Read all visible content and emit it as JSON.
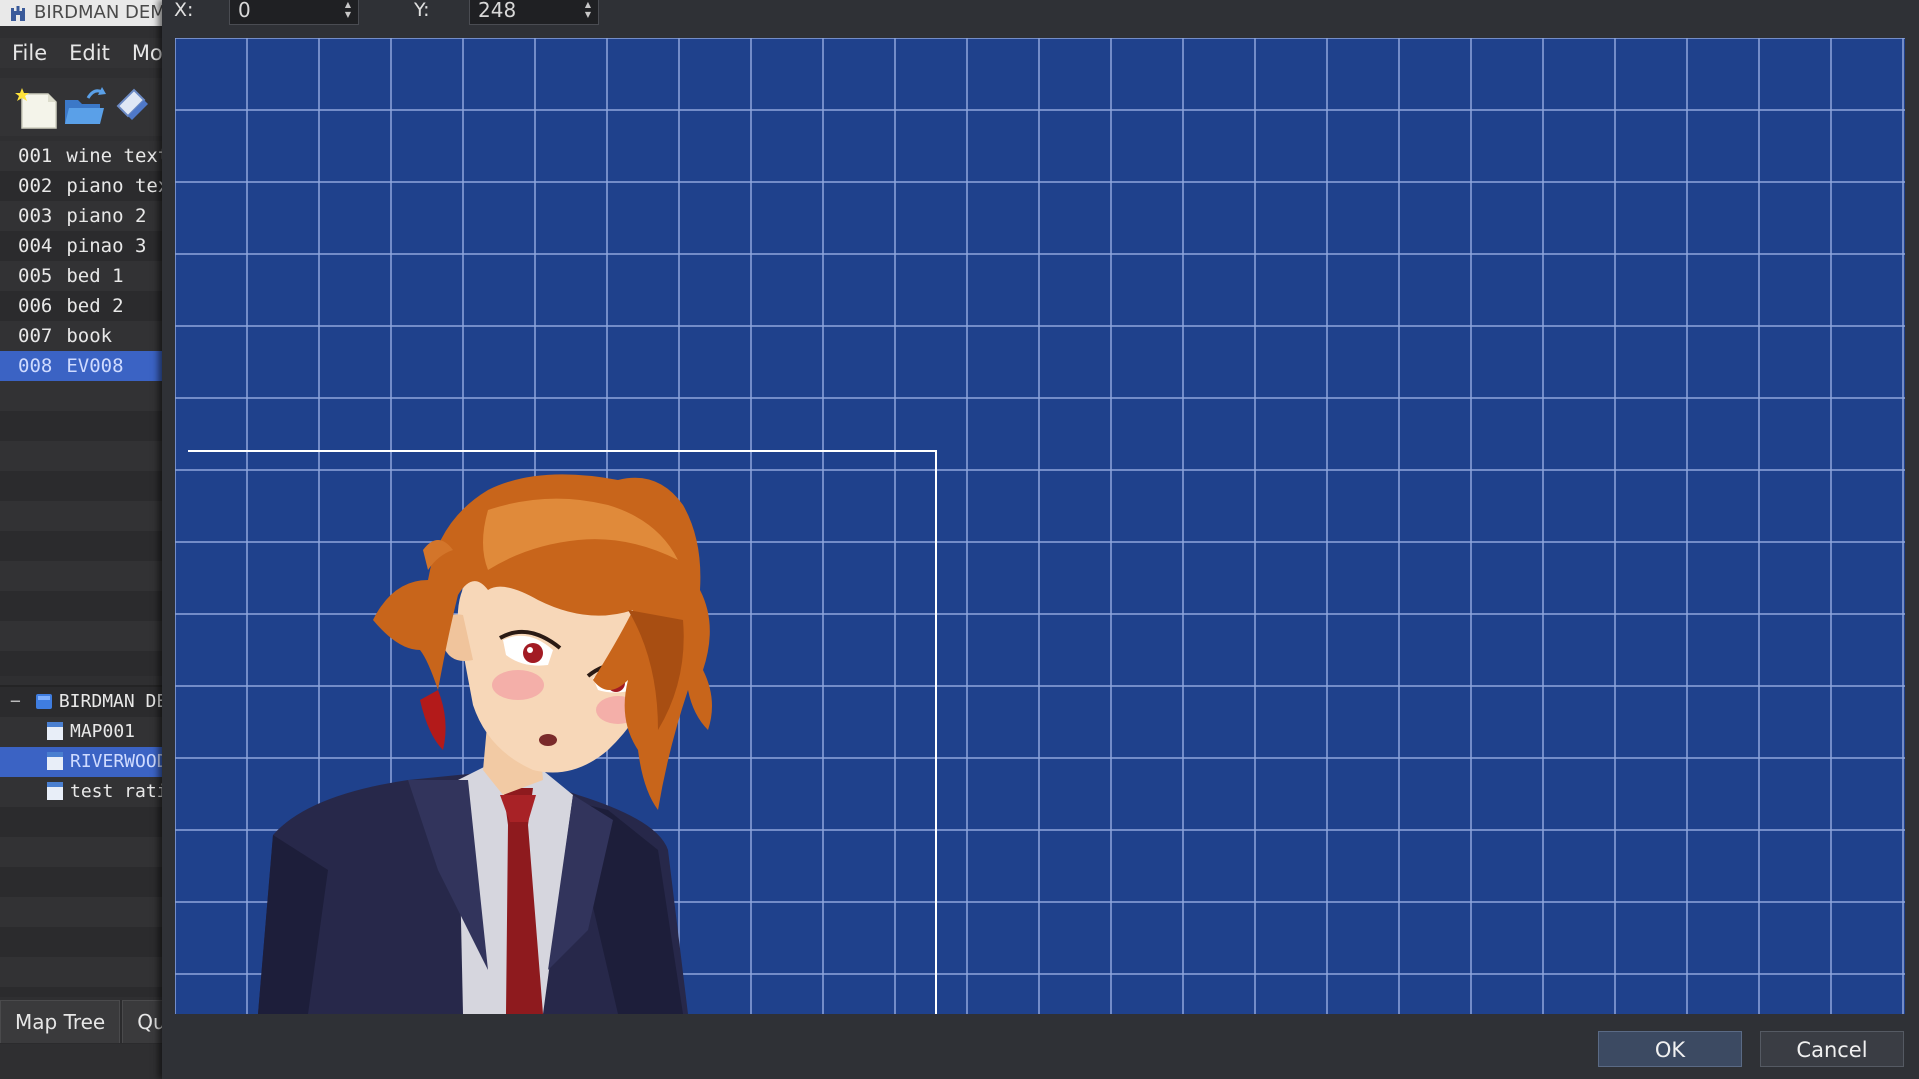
{
  "editor": {
    "title": "BIRDMAN DEMO",
    "menu": [
      "File",
      "Edit",
      "Mode"
    ],
    "toolbar_icons": [
      "new-project-icon",
      "open-folder-icon",
      "save-disk-icon"
    ],
    "events": [
      {
        "num": "001",
        "name": "wine text"
      },
      {
        "num": "002",
        "name": "piano text"
      },
      {
        "num": "003",
        "name": "piano 2"
      },
      {
        "num": "004",
        "name": "pinao 3"
      },
      {
        "num": "005",
        "name": "bed 1"
      },
      {
        "num": "006",
        "name": "bed 2"
      },
      {
        "num": "007",
        "name": "book"
      },
      {
        "num": "008",
        "name": "EV008",
        "selected": true
      }
    ],
    "map_tree": {
      "root": "BIRDMAN DEMO",
      "maps": [
        {
          "name": "MAP001"
        },
        {
          "name": "RIVERWOOD",
          "selected": true
        },
        {
          "name": "test rating"
        }
      ]
    },
    "bottom_tabs": [
      "Map Tree",
      "Quick"
    ]
  },
  "dialog": {
    "x_label": "X:",
    "x_value": "0",
    "y_label": "Y:",
    "y_value": "248",
    "ok_label": "OK",
    "cancel_label": "Cancel"
  },
  "colors": {
    "preview_background": "#1f418c",
    "grid_line": "#8fa6dc",
    "selection": "#3b63c4"
  }
}
